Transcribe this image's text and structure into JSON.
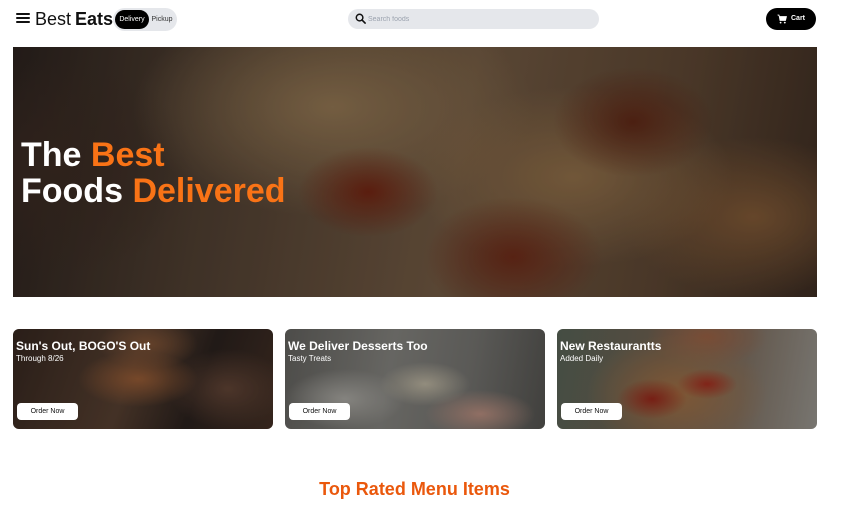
{
  "navbar": {
    "brand_light": "Best",
    "brand_bold": "Eats",
    "menu_icon": "hamburger-menu-icon",
    "mode_toggle": {
      "active": "Delivery",
      "inactive": "Pickup"
    },
    "search": {
      "placeholder": "Search foods",
      "icon": "search-icon"
    },
    "cart": {
      "label": "Cart",
      "icon": "shopping-cart-icon"
    }
  },
  "hero": {
    "line1_plain": "The",
    "line1_accent": "Best",
    "line2_plain": "Foods",
    "line2_accent": "Delivered"
  },
  "promos": [
    {
      "title": "Sun's Out, BOGO'S Out",
      "subtitle": "Through 8/26",
      "button": "Order Now"
    },
    {
      "title": "We Deliver Desserts Too",
      "subtitle": "Tasty Treats",
      "button": "Order Now"
    },
    {
      "title": "New Restaurantts",
      "subtitle": "Added Daily",
      "button": "Order Now"
    }
  ],
  "section": {
    "title": "Top Rated Menu Items"
  },
  "colors": {
    "accent": "#f97316",
    "heading": "#ea580c",
    "pill_bg": "#e5e7eb",
    "dark": "#000000"
  }
}
